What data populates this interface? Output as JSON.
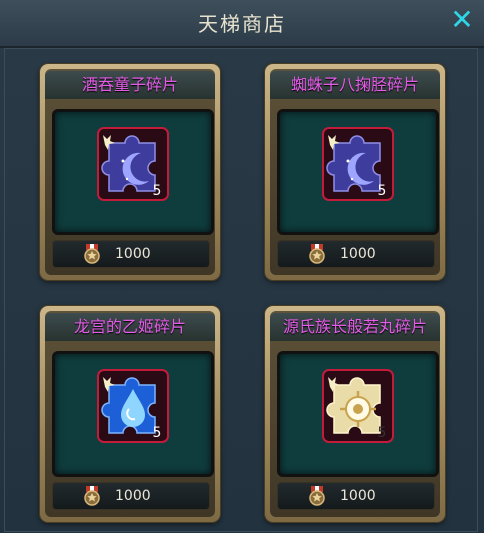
{
  "header": {
    "title": "天梯商店",
    "close_icon": "close-icon"
  },
  "items": [
    {
      "name": "酒吞童子碎片",
      "price": "1000",
      "count": "5",
      "icon": "moon-fragment-icon",
      "theme": "moon"
    },
    {
      "name": "蜘蛛子八掬胫碎片",
      "price": "1000",
      "count": "5",
      "icon": "moon-fragment-icon",
      "theme": "moon"
    },
    {
      "name": "龙宫的乙姬碎片",
      "price": "1000",
      "count": "5",
      "icon": "water-fragment-icon",
      "theme": "water"
    },
    {
      "name": "源氏族长般若丸碎片",
      "price": "1000",
      "count": "5",
      "icon": "sun-fragment-icon",
      "theme": "sun"
    }
  ],
  "colors": {
    "item_name": "#e45be8",
    "close": "#2fd6e8",
    "title": "#e8e3cf"
  }
}
